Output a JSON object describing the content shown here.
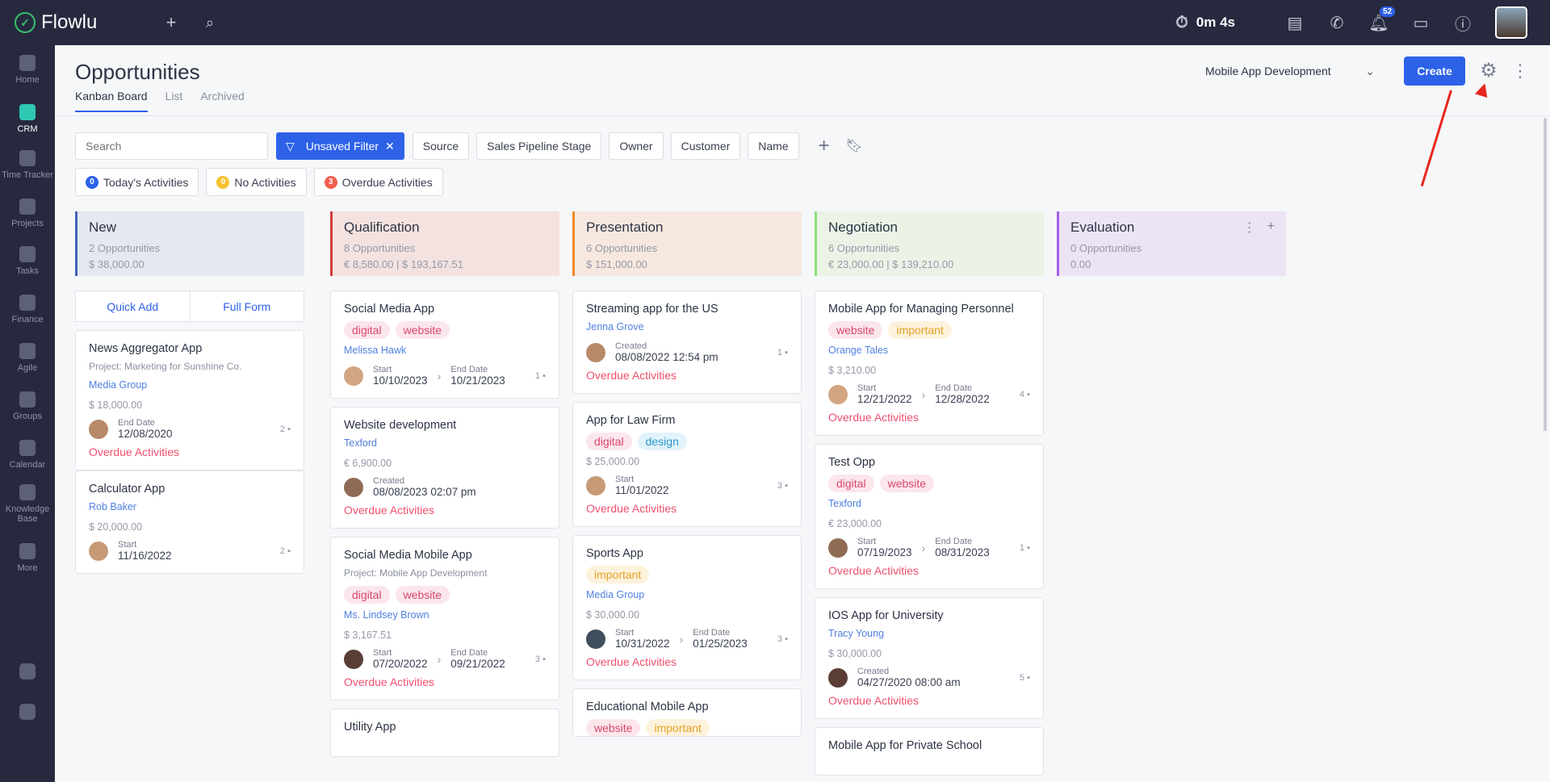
{
  "topbar": {
    "brand": "Flowlu",
    "timer": "0m 4s",
    "notifications_count": "52"
  },
  "sidebar": {
    "items": [
      {
        "label": "Home"
      },
      {
        "label": "CRM"
      },
      {
        "label": "Time Tracker"
      },
      {
        "label": "Projects"
      },
      {
        "label": "Tasks"
      },
      {
        "label": "Finance"
      },
      {
        "label": "Agile"
      },
      {
        "label": "Groups"
      },
      {
        "label": "Calendar"
      },
      {
        "label": "Knowledge Base"
      },
      {
        "label": "More"
      }
    ]
  },
  "header": {
    "title": "Opportunities",
    "tabs": [
      "Kanban Board",
      "List",
      "Archived"
    ],
    "pipeline": "Mobile App Development",
    "create_label": "Create"
  },
  "filters": {
    "search_placeholder": "Search",
    "active_filter": "Unsaved Filter",
    "buttons": [
      "Source",
      "Sales Pipeline Stage",
      "Owner",
      "Customer",
      "Name"
    ]
  },
  "activities": [
    {
      "count": "0",
      "label": "Today's Activities",
      "color": "#2d62e8"
    },
    {
      "count": "0",
      "label": "No Activities",
      "color": "#f5c12e"
    },
    {
      "count": "3",
      "label": "Overdue Activities",
      "color": "#f0604f"
    }
  ],
  "columns": [
    {
      "title": "New",
      "count": "2 Opportunities",
      "sum": "$ 38,000.00",
      "color": "#3f64b4",
      "bg": "#e4e8f0",
      "quick_add": "Quick Add",
      "full_form": "Full Form",
      "cards": [
        {
          "name": "News Aggregator App",
          "project": "Project: Marketing for Sunshine Co.",
          "customer": "Media Group",
          "amount": "$ 18,000.00",
          "date1_label": "End Date",
          "date1": "12/08/2020",
          "comments": "2",
          "overdue": "Overdue Activities"
        },
        {
          "name": "Calculator App",
          "customer": "Rob Baker",
          "amount": "$ 20,000.00",
          "date1_label": "Start",
          "date1": "11/16/2022",
          "comments": "2"
        }
      ]
    },
    {
      "title": "Qualification",
      "count": "8 Opportunities",
      "sum": "€ 8,580.00 | $ 193,167.51",
      "color": "#d33b3b",
      "bg": "#f3e2df",
      "cards": [
        {
          "name": "Social Media App",
          "tags": [
            "digital",
            "website"
          ],
          "customer": "Melissa Hawk",
          "date1_label": "Start",
          "date1": "10/10/2023",
          "date2_label": "End Date",
          "date2": "10/21/2023",
          "comments": "1"
        },
        {
          "name": "Website development",
          "customer": "Texford",
          "amount": "€ 6,900.00",
          "date1_label": "Created",
          "date1": "08/08/2023 02:07 pm",
          "overdue": "Overdue Activities"
        },
        {
          "name": "Social Media Mobile App",
          "project": "Project: Mobile App Development",
          "tags": [
            "digital",
            "website"
          ],
          "customer": "Ms. Lindsey Brown",
          "amount": "$ 3,167.51",
          "date1_label": "Start",
          "date1": "07/20/2022",
          "date2_label": "End Date",
          "date2": "09/21/2022",
          "comments": "3",
          "overdue": "Overdue Activities"
        },
        {
          "name": "Utility App"
        }
      ]
    },
    {
      "title": "Presentation",
      "count": "6 Opportunities",
      "sum": "$ 151,000.00",
      "color": "#f0872a",
      "bg": "#f6e8de",
      "cards": [
        {
          "name": "Streaming app for the US",
          "customer": "Jenna Grove",
          "date1_label": "Created",
          "date1": "08/08/2022 12:54 pm",
          "comments": "1",
          "overdue": "Overdue Activities"
        },
        {
          "name": "App for Law Firm",
          "tags": [
            "digital",
            "design"
          ],
          "amount": "$ 25,000.00",
          "date1_label": "Start",
          "date1": "11/01/2022",
          "comments": "3",
          "overdue": "Overdue Activities"
        },
        {
          "name": "Sports App",
          "tags": [
            "important"
          ],
          "customer": "Media Group",
          "amount": "$ 30,000.00",
          "date1_label": "Start",
          "date1": "10/31/2022",
          "date2_label": "End Date",
          "date2": "01/25/2023",
          "comments": "3",
          "overdue": "Overdue Activities"
        },
        {
          "name": "Educational Mobile App",
          "tags": [
            "website",
            "important"
          ]
        }
      ]
    },
    {
      "title": "Negotiation",
      "count": "6 Opportunities",
      "sum": "€ 23,000.00 | $ 139,210.00",
      "color": "#8ee07a",
      "bg": "#eaf3e6",
      "cards": [
        {
          "name": "Mobile App for Managing Personnel",
          "tags": [
            "website",
            "important"
          ],
          "customer": "Orange Tales",
          "amount": "$ 3,210.00",
          "date1_label": "Start",
          "date1": "12/21/2022",
          "date2_label": "End Date",
          "date2": "12/28/2022",
          "comments": "4",
          "overdue": "Overdue Activities"
        },
        {
          "name": "Test Opp",
          "tags": [
            "digital",
            "website"
          ],
          "customer": "Texford",
          "amount": "€ 23,000.00",
          "date1_label": "Start",
          "date1": "07/19/2023",
          "date2_label": "End Date",
          "date2": "08/31/2023",
          "comments": "1",
          "overdue": "Overdue Activities"
        },
        {
          "name": "IOS App for University",
          "customer": "Tracy Young",
          "amount": "$ 30,000.00",
          "date1_label": "Created",
          "date1": "04/27/2020 08:00 am",
          "comments": "5",
          "overdue": "Overdue Activities"
        },
        {
          "name": "Mobile App for Private School"
        }
      ]
    },
    {
      "title": "Evaluation",
      "count": "0 Opportunities",
      "sum": "0.00",
      "color": "#a560e8",
      "bg": "#ece3f5",
      "cards": []
    }
  ]
}
